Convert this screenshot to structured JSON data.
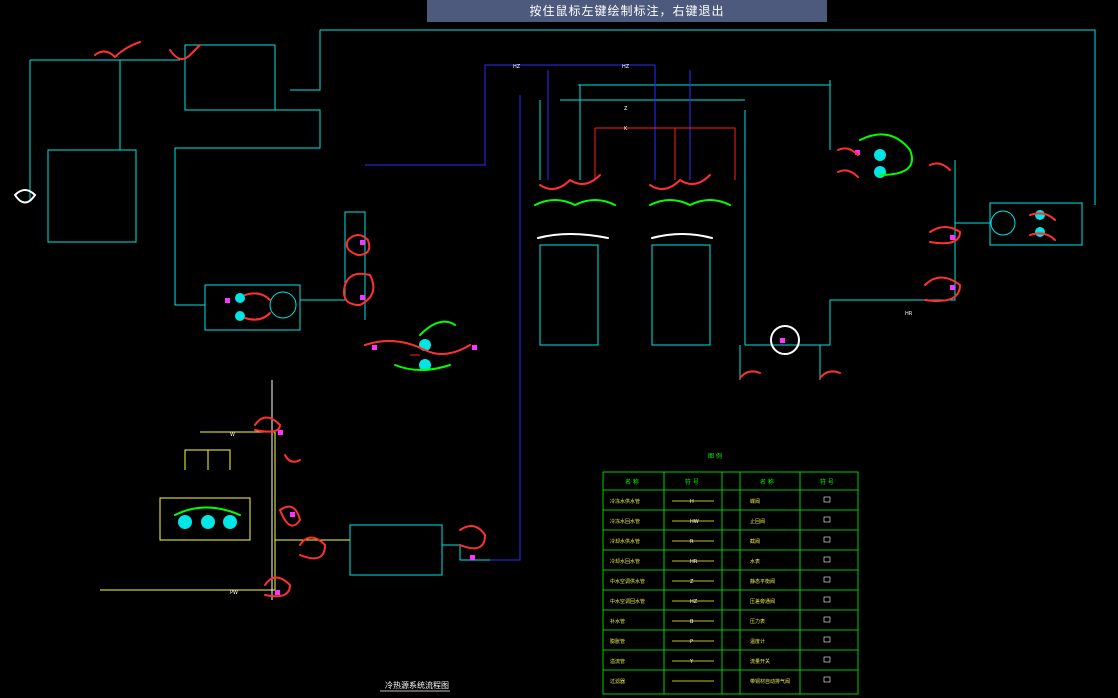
{
  "status_hint": "按住鼠标左键绘制标注，右键退出",
  "drawing": {
    "title": "冷热源系统流程图",
    "labels": {
      "hz": "HZ",
      "z": "Z",
      "k": "K",
      "hr": "HR",
      "pw": "PW",
      "w": "W"
    }
  },
  "legend": {
    "title": "图 例",
    "headers": [
      "名 称",
      "符 号",
      "名 称",
      "符 号"
    ],
    "left_rows": [
      "冷冻水供水管",
      "冷冻水回水管",
      "冷却水供水管",
      "冷却水回水管",
      "中水空调供水管",
      "中水空调回水管",
      "补水管",
      "膨胀管",
      "溢流管",
      "过滤器",
      "闸阀"
    ],
    "left_codes": [
      "H",
      "HW",
      "R",
      "HR",
      "Z",
      "HZ",
      "B",
      "P",
      "Y",
      "",
      ""
    ],
    "right_rows": [
      "蝶阀",
      "止回阀",
      "截阀",
      "水表",
      "静态平衡阀",
      "压差旁通阀",
      "压力表",
      "温度计",
      "流量开关",
      "带铜材自动排气阀"
    ]
  },
  "colors": {
    "cyan": "#00e5e5",
    "blue": "#2b2bff",
    "red": "#ff2020",
    "yellow": "#ffff33",
    "green": "#00ff00",
    "magenta": "#ff33ff",
    "white": "#ffffff"
  }
}
